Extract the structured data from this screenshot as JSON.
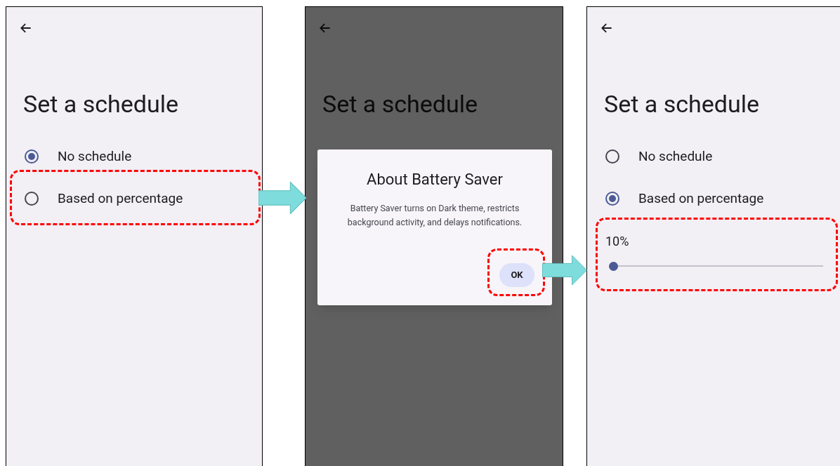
{
  "panels": [
    {
      "title": "Set a schedule",
      "dimmed": false,
      "options": [
        {
          "label": "No schedule",
          "selected": true,
          "highlighted": false
        },
        {
          "label": "Based on percentage",
          "selected": false,
          "highlighted": true
        }
      ]
    },
    {
      "title": "Set a schedule",
      "dimmed": true,
      "dialog": {
        "title": "About Battery Saver",
        "message": "Battery Saver turns on Dark theme, restricts background activity, and delays notifications.",
        "button": {
          "label": "OK",
          "highlighted": true
        }
      }
    },
    {
      "title": "Set a schedule",
      "dimmed": false,
      "options": [
        {
          "label": "No schedule",
          "selected": false,
          "highlighted": false
        },
        {
          "label": "Based on percentage",
          "selected": true,
          "highlighted": false
        }
      ],
      "slider": {
        "reading": "10%",
        "level": 0,
        "highlighted": true
      }
    }
  ]
}
